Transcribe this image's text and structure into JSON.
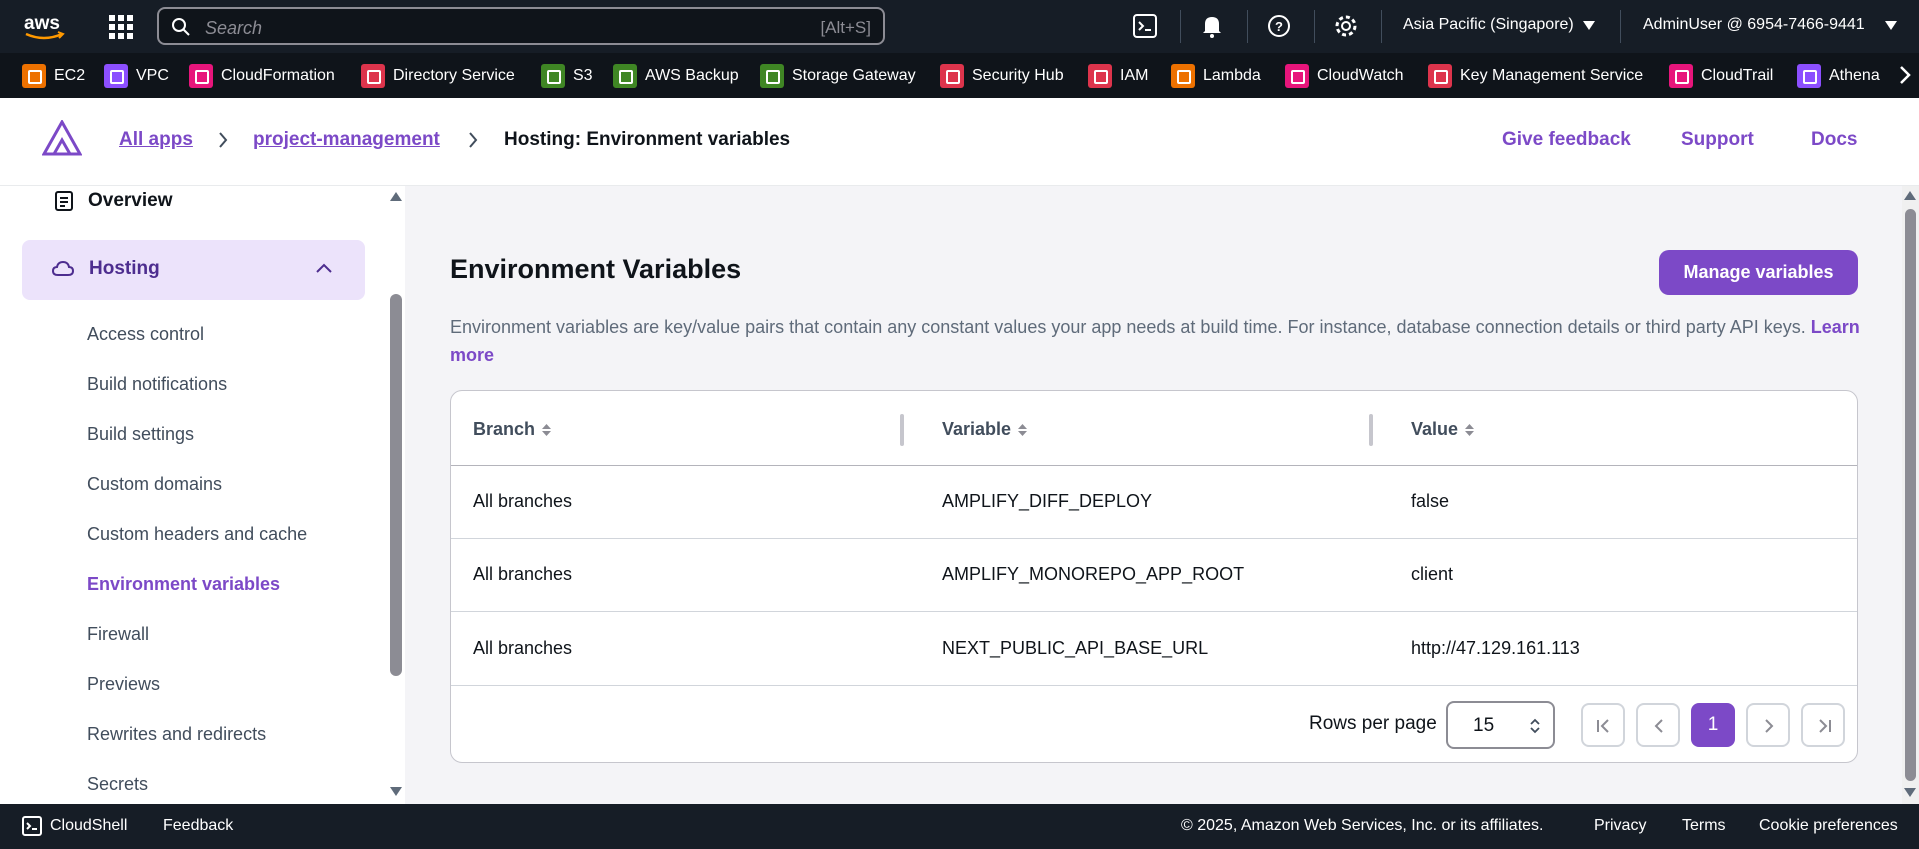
{
  "topnav": {
    "logo_text": "aws",
    "search_placeholder": "Search",
    "search_shortcut": "[Alt+S]",
    "region": "Asia Pacific (Singapore)",
    "account": "AdminUser @ 6954-7466-9441"
  },
  "favorites": [
    {
      "label": "EC2",
      "color": "#ed7100"
    },
    {
      "label": "VPC",
      "color": "#8c4fff"
    },
    {
      "label": "CloudFormation",
      "color": "#e7157b"
    },
    {
      "label": "Directory Service",
      "color": "#dd344c"
    },
    {
      "label": "S3",
      "color": "#3f8624"
    },
    {
      "label": "AWS Backup",
      "color": "#3f8624"
    },
    {
      "label": "Storage Gateway",
      "color": "#3f8624"
    },
    {
      "label": "Security Hub",
      "color": "#dd344c"
    },
    {
      "label": "IAM",
      "color": "#dd344c"
    },
    {
      "label": "Lambda",
      "color": "#ed7100"
    },
    {
      "label": "CloudWatch",
      "color": "#e7157b"
    },
    {
      "label": "Key Management Service",
      "color": "#dd344c"
    },
    {
      "label": "CloudTrail",
      "color": "#e7157b"
    },
    {
      "label": "Athena",
      "color": "#8c4fff"
    }
  ],
  "breadcrumb": {
    "all_apps": "All apps",
    "app": "project-management",
    "current": "Hosting: Environment variables"
  },
  "header_links": {
    "feedback": "Give feedback",
    "support": "Support",
    "docs": "Docs"
  },
  "sidebar": {
    "overview": "Overview",
    "hosting": "Hosting",
    "items": [
      "Access control",
      "Build notifications",
      "Build settings",
      "Custom domains",
      "Custom headers and cache",
      "Environment variables",
      "Firewall",
      "Previews",
      "Rewrites and redirects",
      "Secrets"
    ]
  },
  "main": {
    "title": "Environment Variables",
    "manage_button": "Manage variables",
    "description": "Environment variables are key/value pairs that contain any constant values your app needs at build time. For instance, database connection details or third party API keys.",
    "learn_more": "Learn more",
    "table": {
      "columns": [
        "Branch",
        "Variable",
        "Value"
      ],
      "rows": [
        [
          "All branches",
          "AMPLIFY_DIFF_DEPLOY",
          "false"
        ],
        [
          "All branches",
          "AMPLIFY_MONOREPO_APP_ROOT",
          "client"
        ],
        [
          "All branches",
          "NEXT_PUBLIC_API_BASE_URL",
          "http://47.129.161.113"
        ]
      ]
    },
    "pagination": {
      "rows_per_page_label": "Rows per page",
      "rows_per_page": "15",
      "current_page": "1"
    }
  },
  "footer": {
    "cloudshell": "CloudShell",
    "feedback": "Feedback",
    "copyright": "© 2025, Amazon Web Services, Inc. or its affiliates.",
    "privacy": "Privacy",
    "terms": "Terms",
    "cookies": "Cookie preferences"
  },
  "colors": {
    "accent": "#7c49c7",
    "topnav": "#161d26",
    "hosting_highlight": "#ece3fb"
  }
}
